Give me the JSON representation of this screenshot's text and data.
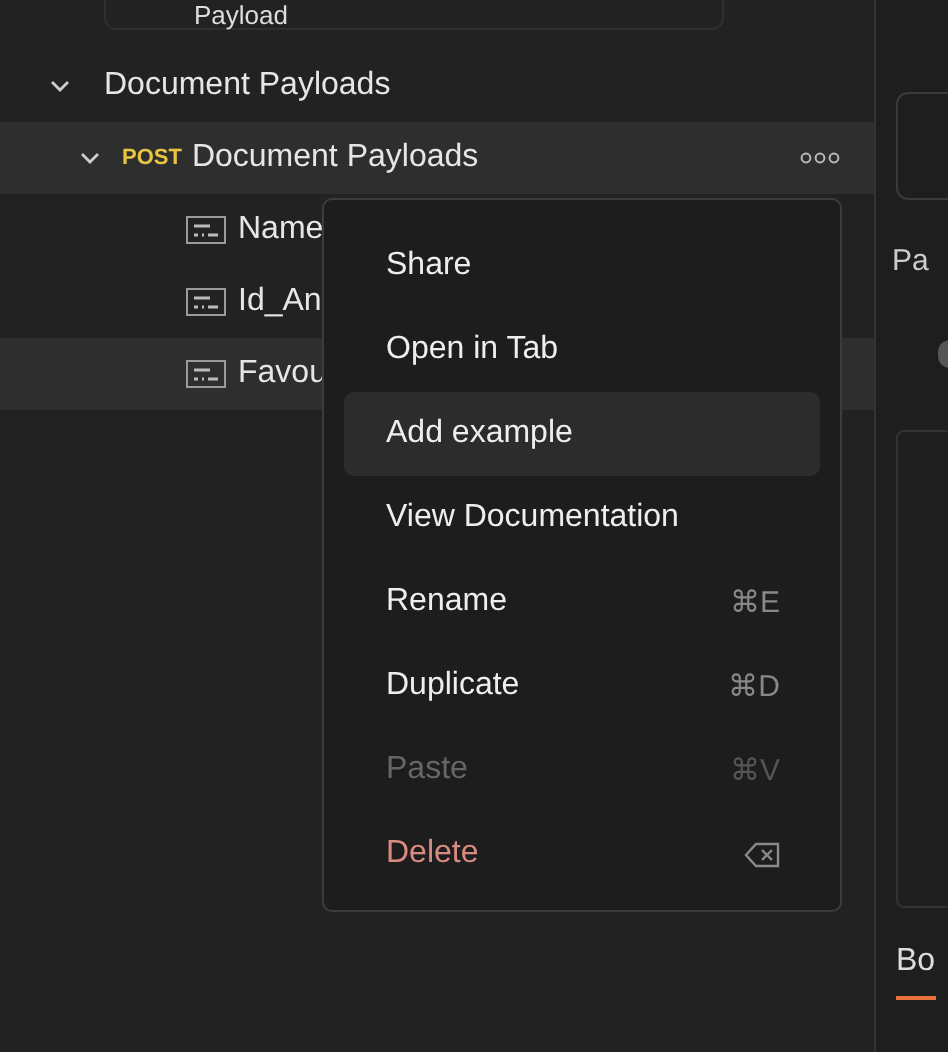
{
  "search": {
    "value": "Payload"
  },
  "tree": [
    {
      "label": "Document Payloads",
      "expanded": true,
      "highlighted": false,
      "children": [
        {
          "method": "POST",
          "label": "Document Payloads",
          "expanded": true,
          "highlighted": true,
          "children": [
            {
              "label": "Name",
              "highlighted": false
            },
            {
              "label": "Id_An",
              "highlighted": false
            },
            {
              "label": "Favou",
              "highlighted": true
            }
          ]
        }
      ]
    }
  ],
  "context_menu": {
    "items": [
      {
        "label": "Share",
        "kind": "plain",
        "highlighted": false,
        "disabled": false
      },
      {
        "label": "Open in Tab",
        "kind": "plain",
        "highlighted": false,
        "disabled": false
      },
      {
        "label": "Add example",
        "kind": "plain",
        "highlighted": true,
        "disabled": false
      },
      {
        "label": "View Documentation",
        "kind": "plain",
        "highlighted": false,
        "disabled": false
      },
      {
        "label": "Rename",
        "kind": "plain",
        "shortcut": "⌘E",
        "highlighted": false,
        "disabled": false
      },
      {
        "label": "Duplicate",
        "kind": "plain",
        "shortcut": "⌘D",
        "highlighted": false,
        "disabled": false
      },
      {
        "label": "Paste",
        "kind": "plain",
        "shortcut": "⌘V",
        "highlighted": false,
        "disabled": true
      },
      {
        "label": "Delete",
        "kind": "delete",
        "highlighted": false,
        "disabled": false
      }
    ]
  },
  "right_panel": {
    "label_1": "Pa",
    "tab": {
      "label": "Bo",
      "selected": true
    }
  }
}
